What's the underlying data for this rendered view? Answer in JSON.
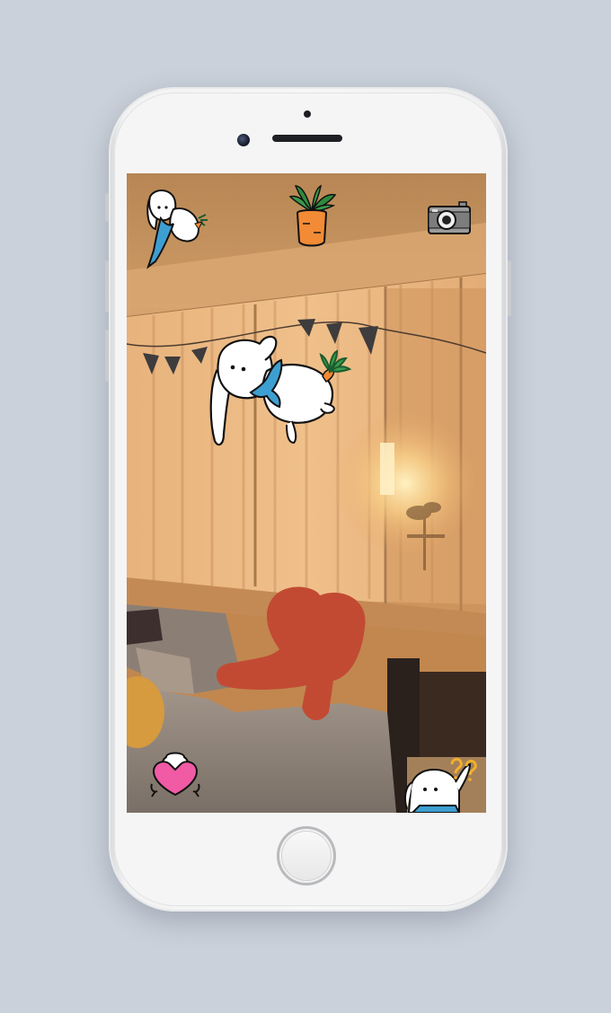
{
  "app": {
    "name": "",
    "mode": "AR camera"
  },
  "toolbar": {
    "left_icon": "bunny-icon",
    "center_icon": "carrot-icon",
    "right_icon": "camera-icon"
  },
  "bottom_bar": {
    "left_icon": "heart-bunny-icon",
    "right_icon": "help-bunny-icon"
  },
  "colors": {
    "wall": "#d79f66",
    "scarf": "#3d9fd1",
    "carrot": "#f38a35",
    "heart": "#f15aa4",
    "pillow": "#c94a35",
    "sofa": "#93877e"
  }
}
